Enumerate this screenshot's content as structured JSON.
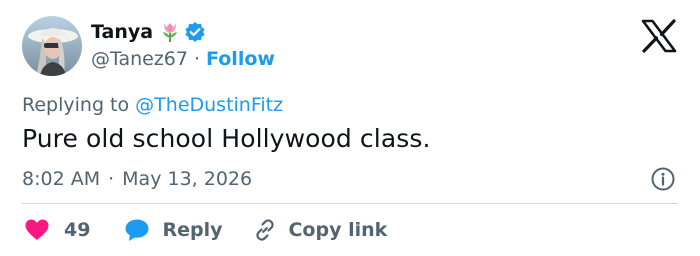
{
  "user": {
    "display_name": "Tanya",
    "handle": "@Tanez67",
    "separator": "·",
    "follow_label": "Follow",
    "name_emoji_icon": "tulip-icon",
    "verified_icon": "verified-badge-icon"
  },
  "brand": {
    "logo_icon": "x-logo-icon"
  },
  "reply_context": {
    "prefix": "Replying to",
    "mention": "@TheDustinFitz"
  },
  "tweet": {
    "text": "Pure old school Hollywood class.",
    "time": "8:02 AM",
    "separator": "·",
    "date": "May 13, 2026"
  },
  "actions": {
    "like_count": "49",
    "reply_label": "Reply",
    "copy_link_label": "Copy link"
  },
  "colors": {
    "accent": "#1d9bf0",
    "like": "#f91880",
    "secondary_text": "#536471",
    "primary_text": "#0f1419"
  }
}
